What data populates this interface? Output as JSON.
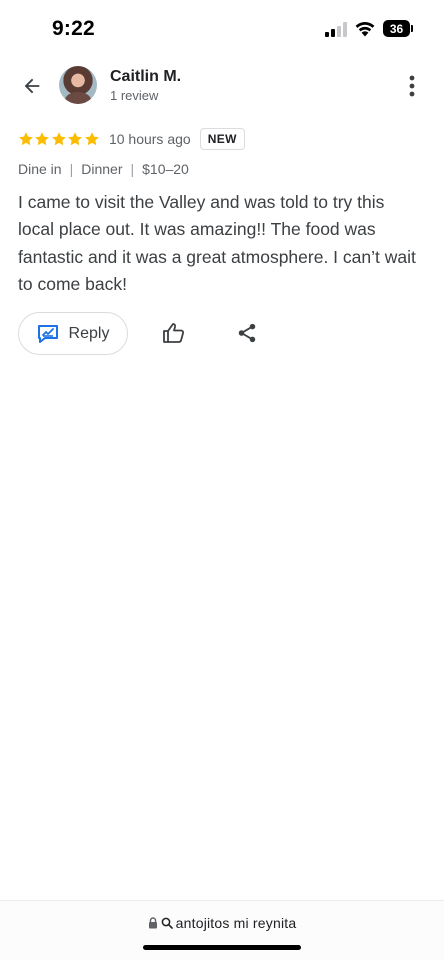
{
  "status_bar": {
    "time": "9:22",
    "battery_level": "36",
    "signal_bars_active": 2,
    "signal_bars_total": 4
  },
  "header": {
    "reviewer_name": "Caitlin M.",
    "reviewer_meta": "1 review",
    "back_icon": "arrow-left-icon",
    "more_icon": "more-vert-icon"
  },
  "review": {
    "rating": 5,
    "rating_max": 5,
    "time_ago": "10 hours ago",
    "badge": "NEW",
    "meta": [
      "Dine in",
      "Dinner",
      "$10–20"
    ],
    "meta_separator": "|",
    "text": "I came to visit the Valley and was told to try this local place out. It was amazing!! The food was fantastic and it was a great atmosphere. I can’t wait to come back!"
  },
  "actions": {
    "reply_label": "Reply",
    "reply_icon": "reply-icon",
    "like_icon": "thumb-up-icon",
    "share_icon": "share-icon"
  },
  "browser": {
    "url": "antojitos mi reynita"
  },
  "colors": {
    "star": "#fbbc04",
    "accent_blue": "#1a73e8",
    "text_primary": "#202124",
    "text_secondary": "#5f6368"
  }
}
